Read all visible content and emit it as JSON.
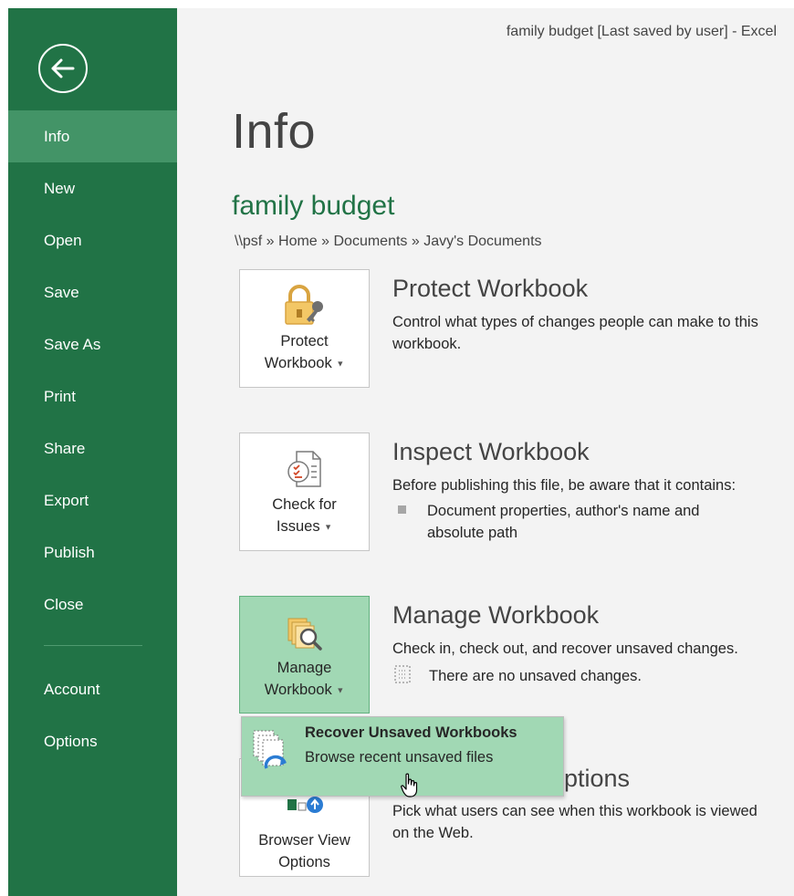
{
  "window": {
    "title": "family budget [Last saved by user] - Excel"
  },
  "sidebar": {
    "back_icon": "arrow-left-circle-icon",
    "items": [
      {
        "label": "Info",
        "active": true
      },
      {
        "label": "New"
      },
      {
        "label": "Open"
      },
      {
        "label": "Save"
      },
      {
        "label": "Save As"
      },
      {
        "label": "Print"
      },
      {
        "label": "Share"
      },
      {
        "label": "Export"
      },
      {
        "label": "Publish"
      },
      {
        "label": "Close"
      }
    ],
    "bottom_items": [
      {
        "label": "Account"
      },
      {
        "label": "Options"
      }
    ],
    "colors": {
      "background": "#217346",
      "active": "#439467"
    }
  },
  "main": {
    "page_title": "Info",
    "doc_name": "family budget",
    "path": "\\\\psf » Home » Documents » Javy's Documents",
    "sections": {
      "protect": {
        "tile_line1": "Protect",
        "tile_line2": "Workbook",
        "title": "Protect Workbook",
        "desc": "Control what types of changes people can make to this workbook.",
        "icon": "lock-key-icon"
      },
      "inspect": {
        "tile_line1": "Check for",
        "tile_line2": "Issues",
        "title": "Inspect Workbook",
        "desc": "Before publishing this file, be aware that it contains:",
        "bullet": "Document properties, author's name and absolute path",
        "icon": "inspect-document-icon"
      },
      "manage": {
        "tile_line1": "Manage",
        "tile_line2": "Workbook",
        "title": "Manage Workbook",
        "desc": "Check in, check out, and recover unsaved changes.",
        "note": "There are no unsaved changes.",
        "icon": "manage-workbook-icon"
      },
      "browser": {
        "tile_line1": "Browser View",
        "tile_line2": "Options",
        "title_partial": "ptions",
        "desc": "Pick what users can see when this workbook is viewed on the Web.",
        "icon": "browser-view-icon"
      }
    },
    "dropdown": {
      "item_title": "Recover Unsaved Workbooks",
      "item_sub": "Browse recent unsaved files",
      "icon": "recover-files-icon"
    }
  }
}
